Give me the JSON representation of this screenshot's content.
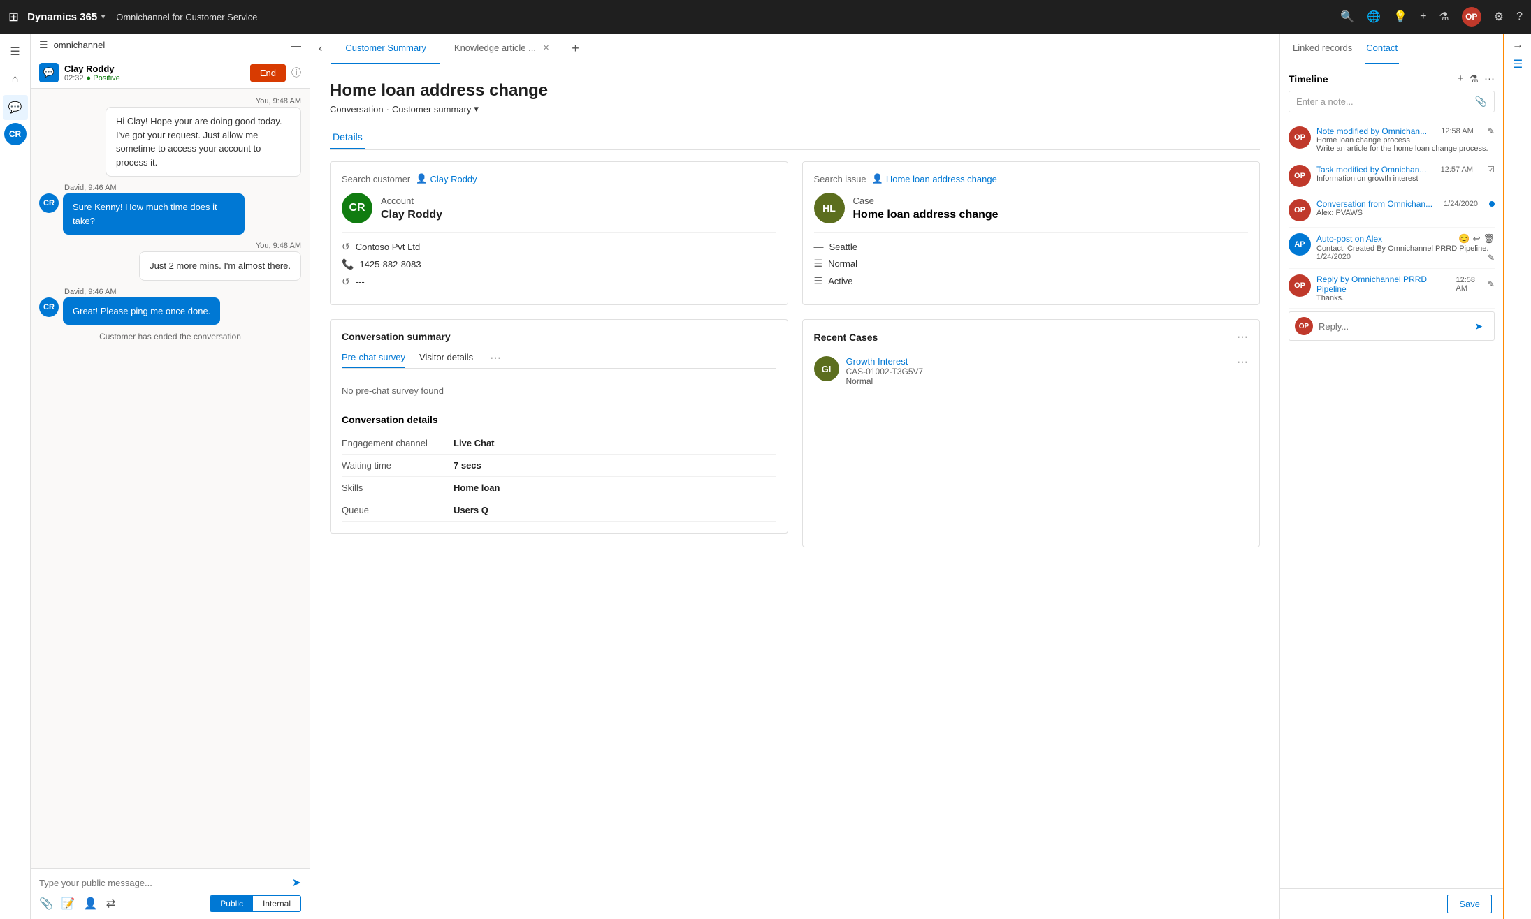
{
  "topbar": {
    "waffle_icon": "⊞",
    "brand": "Dynamics 365",
    "brand_chevron": "▾",
    "app_name": "Omnichannel for Customer Service",
    "search_icon": "🔍",
    "globe_icon": "🌐",
    "lightbulb_icon": "💡",
    "plus_icon": "+",
    "filter_icon": "⚙",
    "avatar_initials": "OP",
    "settings_icon": "⚙",
    "help_icon": "?"
  },
  "left_sidebar": {
    "home_icon": "⌂",
    "chat_icon": "💬",
    "avatar_initials": "CR"
  },
  "chat_panel": {
    "header_label": "omnichannel",
    "session": {
      "name": "Clay Roddy",
      "time": "02:32",
      "sentiment": "Positive",
      "end_btn": "End"
    },
    "messages": [
      {
        "type": "right",
        "timestamp": "You, 9:48 AM",
        "text": "Hi Clay! Hope your are doing good today. I've got your request. Just allow me sometime to access your account to process it."
      },
      {
        "type": "left",
        "sender": "David, 9:46 AM",
        "initials": "CR",
        "text": "Sure Kenny! How much time does it take?"
      },
      {
        "type": "right",
        "timestamp": "You, 9:48 AM",
        "text": "Just 2 more mins. I'm almost there."
      },
      {
        "type": "left",
        "sender": "David, 9:46 AM",
        "initials": "CR",
        "text": "Great! Please ping me once done."
      },
      {
        "type": "system",
        "text": "Customer has ended the conversation"
      }
    ],
    "input_placeholder": "Type your public message...",
    "mode_public": "Public",
    "mode_internal": "Internal"
  },
  "tabs": {
    "customer_summary": "Customer Summary",
    "knowledge_article": "Knowledge article ...",
    "add_tab": "+"
  },
  "main": {
    "title": "Home loan address change",
    "breadcrumb_conversation": "Conversation",
    "breadcrumb_separator": "·",
    "breadcrumb_summary": "Customer summary",
    "active_tab": "Details",
    "customer_card": {
      "search_label": "Search customer",
      "search_link": "Clay Roddy",
      "account_label": "Account",
      "name": "Clay Roddy",
      "initials": "CR",
      "avatar_bg": "#107c10",
      "company": "Contoso Pvt Ltd",
      "phone": "1425-882-8083",
      "extra": "---"
    },
    "case_card": {
      "search_label": "Search issue",
      "search_link": "Home loan address change",
      "case_label": "Case",
      "name": "Home loan address change",
      "initials": "HL",
      "avatar_bg": "#5c6e1e",
      "city": "Seattle",
      "priority": "Normal",
      "status": "Active"
    },
    "conversation_summary": {
      "title": "Conversation summary",
      "tab_prechat": "Pre-chat survey",
      "tab_visitor": "Visitor details",
      "tab_more": "···",
      "no_survey_text": "No pre-chat survey found",
      "details_title": "Conversation details",
      "details": [
        {
          "label": "Engagement channel",
          "value": "Live Chat"
        },
        {
          "label": "Waiting time",
          "value": "7 secs"
        },
        {
          "label": "Skills",
          "value": "Home loan"
        },
        {
          "label": "Queue",
          "value": "Users Q"
        }
      ]
    },
    "recent_cases": {
      "title": "Recent Cases",
      "items": [
        {
          "initials": "GI",
          "avatar_bg": "#5c6e1e",
          "title": "Growth Interest",
          "id": "CAS-01002-T3G5V7",
          "priority": "Normal"
        }
      ]
    }
  },
  "right_panel": {
    "tab_linked": "Linked records",
    "tab_contact": "Contact",
    "timeline_title": "Timeline",
    "note_placeholder": "Enter a note...",
    "items": [
      {
        "initials": "OP",
        "title": "Note modified by Omnichan...",
        "time": "12:58 AM",
        "sub1": "Home loan change process",
        "sub2": "Write an article for the home loan change process.",
        "has_edit": true
      },
      {
        "initials": "OP",
        "title": "Task modified by Omnichan...",
        "time": "12:57 AM",
        "sub1": "Information on growth interest",
        "has_check": true
      },
      {
        "initials": "OP",
        "title": "Conversation from Omnichan...",
        "time": "1/24/2020",
        "sub1": "Alex: PVAWS",
        "has_dot": true
      },
      {
        "initials": "AP",
        "avatar_bg": "#0078d4",
        "title": "Auto-post on Alex",
        "time": "1/24/2020",
        "sub1": "Contact: Created By Omnichannel PRRD Pipeline.",
        "has_actions": true
      },
      {
        "initials": "OP",
        "title": "Reply by Omnichannel PRRD Pipeline",
        "time": "12:58 AM",
        "sub1": "Thanks.",
        "has_edit_small": true
      }
    ],
    "reply_placeholder": "Reply...",
    "save_btn": "Save"
  }
}
